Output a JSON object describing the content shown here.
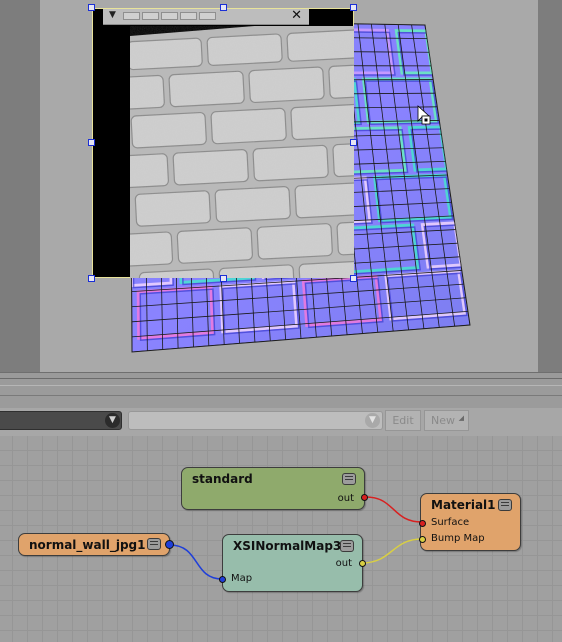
{
  "viewport": {
    "floater": {
      "close_glyph": "✕",
      "menu_glyph": "▼"
    }
  },
  "toolbar": {
    "shader_selector_value": "",
    "secondary_selector_value": "",
    "edit_label": "Edit",
    "new_label": "New"
  },
  "render_tree": {
    "nodes": {
      "standard": {
        "title": "standard",
        "out_label": "out",
        "color": "#8faa6c"
      },
      "xsinormalmap": {
        "title": "XSINormalMap3",
        "out_label": "out",
        "map_label": "Map",
        "color": "#97bdab"
      },
      "normal_wall": {
        "title": "normal_wall_jpg1",
        "color": "#e0a36b"
      },
      "material": {
        "title": "Material1",
        "surface_label": "Surface",
        "bump_label": "Bump Map",
        "color": "#e0a36b"
      }
    },
    "connections": [
      {
        "from": "standard.out",
        "to": "Material1.Surface",
        "color": "#d82020"
      },
      {
        "from": "XSINormalMap3.out",
        "to": "Material1.Bump Map",
        "color": "#d9cf43"
      },
      {
        "from": "normal_wall_jpg1",
        "to": "XSINormalMap3.Map",
        "color": "#1f3fd9"
      }
    ]
  },
  "icons": [
    "floater-menu-icon",
    "close-icon",
    "dropdown-icon",
    "collapse-icon",
    "mouse-cursor-icon"
  ]
}
